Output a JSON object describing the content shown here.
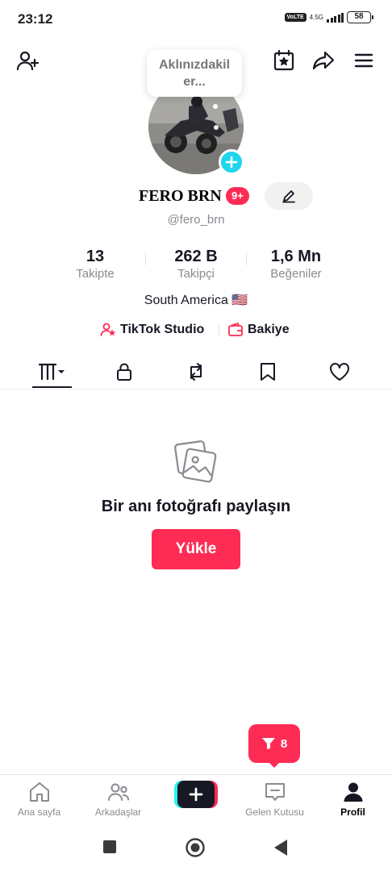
{
  "status_bar": {
    "time": "23:12",
    "volte": "Vo LTE",
    "network": "4.5G",
    "battery": "58"
  },
  "header": {
    "add_friend_icon": "add-person-icon",
    "calendar_icon": "calendar-star-icon",
    "share_icon": "share-arrow-icon",
    "menu_icon": "hamburger-menu-icon"
  },
  "note": {
    "line1": "Aklınızdakil",
    "line2": "er..."
  },
  "profile": {
    "name": "FERO BRN",
    "badge": "9+",
    "username": "@fero_brn",
    "bio": "South America 🇺🇸"
  },
  "stats": [
    {
      "value": "13",
      "label": "Takipte"
    },
    {
      "value": "262 B",
      "label": "Takipçi"
    },
    {
      "value": "1,6 Mn",
      "label": "Beğeniler"
    }
  ],
  "links": {
    "studio": "TikTok Studio",
    "wallet": "Bakiye"
  },
  "tabs": [
    "videos-grid",
    "private-lock",
    "reposts",
    "favorites-bookmark",
    "liked-heart"
  ],
  "empty_state": {
    "title": "Bir anı fotoğrafı paylaşın",
    "button": "Yükle"
  },
  "inbox_tip": {
    "count": "8"
  },
  "bottom_nav": [
    {
      "label": "Ana sayfa",
      "icon": "home-icon"
    },
    {
      "label": "Arkadaşlar",
      "icon": "friends-icon"
    },
    {
      "label": "",
      "icon": "create-plus-icon"
    },
    {
      "label": "Gelen Kutusu",
      "icon": "inbox-icon"
    },
    {
      "label": "Profil",
      "icon": "profile-icon",
      "active": true
    }
  ],
  "colors": {
    "accent": "#fe2c55",
    "cyan": "#20d5ec",
    "text": "#161823",
    "muted": "#8a8b91"
  }
}
